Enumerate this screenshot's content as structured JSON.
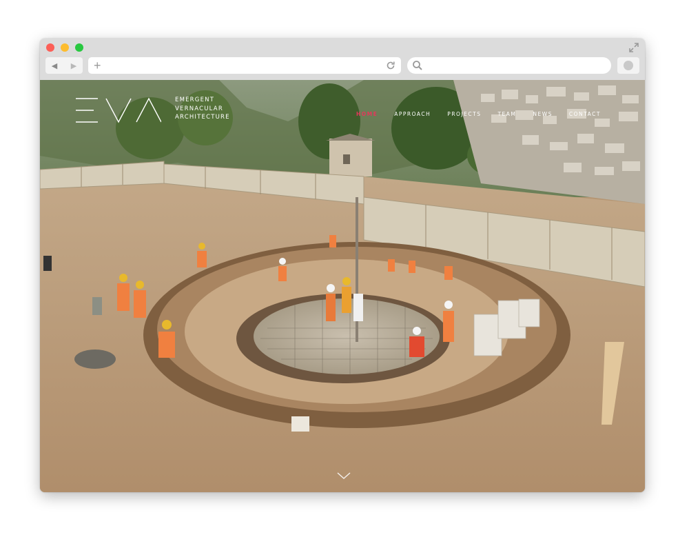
{
  "site": {
    "logo_text": [
      "EMERGENT",
      "VERNACULAR",
      "ARCHITECTURE"
    ],
    "nav": [
      {
        "label": "HOME",
        "active": true
      },
      {
        "label": "APPROACH",
        "active": false
      },
      {
        "label": "PROJECTS",
        "active": false
      },
      {
        "label": "TEAM",
        "active": false
      },
      {
        "label": "NEWS",
        "active": false
      },
      {
        "label": "CONTACT",
        "active": false
      }
    ],
    "accent": "#e3385a"
  },
  "browser": {
    "traffic_light_colors": [
      "#fc5f57",
      "#fdbc2e",
      "#28c840"
    ],
    "url_icon": "plus-icon",
    "reload_icon": "reload-icon",
    "search_icon": "search-icon"
  }
}
